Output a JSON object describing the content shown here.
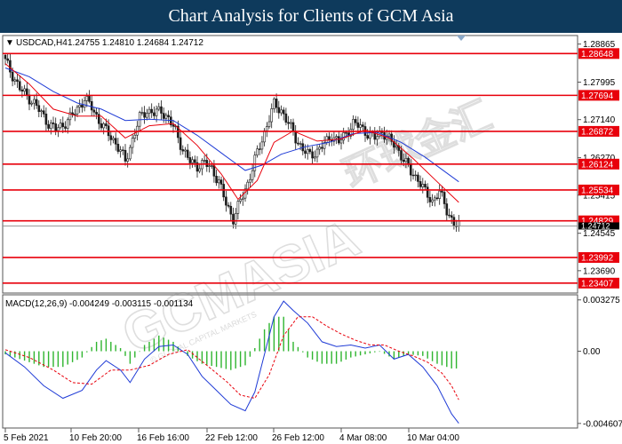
{
  "header": {
    "title": "Chart Analysis for Clients of GCM Asia"
  },
  "watermark": {
    "text": "GCMASIA",
    "subtext": "© GLOBAL CAPITAL MARKETS",
    "cjk": "环球金汇"
  },
  "colors": {
    "banner": "#0e3a5c",
    "candle": "#1c1c1c",
    "level_line": "#e8000b",
    "ma_fast": "#e8000b",
    "ma_slow": "#1f3bd6",
    "macd_hist": "#2fb52f",
    "macd_line": "#1f3bd6",
    "signal_line": "#e8000b",
    "current_price": "#8c8c8c"
  },
  "chart_data": [
    {
      "type": "candlestick",
      "title": "USDCAD,H4",
      "symbol": "USDCAD",
      "timeframe": "H4",
      "ohlc_label": "1.24755 1.24810 1.24684 1.24712",
      "ylim": [
        1.2318,
        1.2906
      ],
      "y_ticks": [
        "1.28865",
        "1.27995",
        "1.27140",
        "1.26270",
        "1.25415",
        "1.24545",
        "1.23690"
      ],
      "x_ticks": [
        "5 Feb 2021",
        "10 Feb 20:00",
        "16 Feb 16:00",
        "22 Feb 12:00",
        "26 Feb 12:00",
        "4 Mar 08:00",
        "10 Mar 04:00"
      ],
      "levels": [
        {
          "value": 1.28648,
          "label": "1.28648"
        },
        {
          "value": 1.27694,
          "label": "1.27694"
        },
        {
          "value": 1.26872,
          "label": "1.26872"
        },
        {
          "value": 1.26124,
          "label": "1.26124"
        },
        {
          "value": 1.25534,
          "label": "1.25534"
        },
        {
          "value": 1.24829,
          "label": "1.24829"
        },
        {
          "value": 1.23992,
          "label": "1.23992"
        },
        {
          "value": 1.23407,
          "label": "1.23407"
        }
      ],
      "current_price": {
        "value": 1.24712,
        "label": "1.24712"
      },
      "close_path": [
        [
          0,
          1.2848
        ],
        [
          3,
          1.2815
        ],
        [
          6,
          1.2785
        ],
        [
          9,
          1.2768
        ],
        [
          12,
          1.2752
        ],
        [
          15,
          1.2728
        ],
        [
          18,
          1.2705
        ],
        [
          21,
          1.2692
        ],
        [
          24,
          1.2702
        ],
        [
          27,
          1.2718
        ],
        [
          30,
          1.2738
        ],
        [
          33,
          1.2762
        ],
        [
          36,
          1.2742
        ],
        [
          39,
          1.2712
        ],
        [
          42,
          1.2688
        ],
        [
          45,
          1.2668
        ],
        [
          48,
          1.2642
        ],
        [
          50,
          1.2618
        ],
        [
          53,
          1.2668
        ],
        [
          56,
          1.2718
        ],
        [
          59,
          1.2735
        ],
        [
          62,
          1.2728
        ],
        [
          65,
          1.2735
        ],
        [
          68,
          1.2715
        ],
        [
          71,
          1.2688
        ],
        [
          74,
          1.2645
        ],
        [
          77,
          1.2618
        ],
        [
          80,
          1.2608
        ],
        [
          83,
          1.2615
        ],
        [
          86,
          1.2602
        ],
        [
          89,
          1.2572
        ],
        [
          92,
          1.2522
        ],
        [
          95,
          1.2488
        ],
        [
          98,
          1.2528
        ],
        [
          101,
          1.2568
        ],
        [
          104,
          1.2622
        ],
        [
          107,
          1.2668
        ],
        [
          110,
          1.2718
        ],
        [
          112,
          1.2748
        ],
        [
          115,
          1.2735
        ],
        [
          118,
          1.2705
        ],
        [
          121,
          1.2672
        ],
        [
          124,
          1.2645
        ],
        [
          127,
          1.2632
        ],
        [
          130,
          1.2642
        ],
        [
          133,
          1.2658
        ],
        [
          136,
          1.2678
        ],
        [
          139,
          1.2662
        ],
        [
          142,
          1.2682
        ],
        [
          145,
          1.2705
        ],
        [
          148,
          1.2698
        ],
        [
          151,
          1.2682
        ],
        [
          154,
          1.2672
        ],
        [
          157,
          1.2688
        ],
        [
          160,
          1.2668
        ],
        [
          163,
          1.2652
        ],
        [
          166,
          1.2622
        ],
        [
          169,
          1.2595
        ],
        [
          172,
          1.2578
        ],
        [
          175,
          1.2548
        ],
        [
          178,
          1.2528
        ],
        [
          181,
          1.2548
        ],
        [
          184,
          1.2508
        ],
        [
          187,
          1.2475
        ],
        [
          189,
          1.2471
        ]
      ],
      "ma_fast": [
        [
          0,
          1.2842
        ],
        [
          10,
          1.2795
        ],
        [
          20,
          1.2738
        ],
        [
          30,
          1.2722
        ],
        [
          40,
          1.2722
        ],
        [
          50,
          1.2672
        ],
        [
          60,
          1.27
        ],
        [
          70,
          1.2705
        ],
        [
          80,
          1.2655
        ],
        [
          90,
          1.259
        ],
        [
          97,
          1.2532
        ],
        [
          105,
          1.2575
        ],
        [
          112,
          1.2662
        ],
        [
          120,
          1.2688
        ],
        [
          130,
          1.2665
        ],
        [
          140,
          1.267
        ],
        [
          150,
          1.269
        ],
        [
          160,
          1.2672
        ],
        [
          170,
          1.2625
        ],
        [
          180,
          1.2572
        ],
        [
          189,
          1.2525
        ]
      ],
      "ma_slow": [
        [
          0,
          1.2832
        ],
        [
          10,
          1.2812
        ],
        [
          20,
          1.2778
        ],
        [
          30,
          1.2752
        ],
        [
          40,
          1.2738
        ],
        [
          50,
          1.2712
        ],
        [
          60,
          1.2715
        ],
        [
          70,
          1.2712
        ],
        [
          80,
          1.2678
        ],
        [
          90,
          1.2638
        ],
        [
          100,
          1.2598
        ],
        [
          107,
          1.261
        ],
        [
          115,
          1.2635
        ],
        [
          125,
          1.2652
        ],
        [
          135,
          1.2662
        ],
        [
          145,
          1.2682
        ],
        [
          155,
          1.2685
        ],
        [
          165,
          1.2662
        ],
        [
          175,
          1.2628
        ],
        [
          185,
          1.2588
        ],
        [
          189,
          1.2572
        ]
      ]
    },
    {
      "type": "macd",
      "title": "MACD(12,26,9)",
      "values_label": "-0.004249 -0.003115 -0.001134",
      "ylim": [
        -0.0049,
        0.0036
      ],
      "y_ticks": [
        "0.003275",
        "0.00",
        "-0.004607"
      ],
      "macd": [
        [
          0,
          -0.0001
        ],
        [
          8,
          -0.001
        ],
        [
          16,
          -0.0022
        ],
        [
          24,
          -0.003
        ],
        [
          32,
          -0.0025
        ],
        [
          38,
          -0.0012
        ],
        [
          42,
          -0.0006
        ],
        [
          48,
          -0.0012
        ],
        [
          52,
          -0.002
        ],
        [
          58,
          -0.0005
        ],
        [
          64,
          0.0003
        ],
        [
          70,
          0.0004
        ],
        [
          76,
          -0.0002
        ],
        [
          82,
          -0.0016
        ],
        [
          88,
          -0.0025
        ],
        [
          94,
          -0.0034
        ],
        [
          100,
          -0.0038
        ],
        [
          104,
          -0.0026
        ],
        [
          108,
          -0.0002
        ],
        [
          112,
          0.0022
        ],
        [
          116,
          0.0032
        ],
        [
          120,
          0.0026
        ],
        [
          126,
          0.0018
        ],
        [
          132,
          0.0006
        ],
        [
          138,
          0.0003
        ],
        [
          144,
          0.0004
        ],
        [
          150,
          0.0002
        ],
        [
          156,
          0.0004
        ],
        [
          162,
          -0.0005
        ],
        [
          168,
          -0.0002
        ],
        [
          174,
          -0.001
        ],
        [
          180,
          -0.0022
        ],
        [
          186,
          -0.004
        ],
        [
          189,
          -0.0046
        ]
      ],
      "signal": [
        [
          0,
          0.0001
        ],
        [
          10,
          -0.0004
        ],
        [
          20,
          -0.0012
        ],
        [
          28,
          -0.002
        ],
        [
          36,
          -0.0021
        ],
        [
          44,
          -0.0012
        ],
        [
          52,
          -0.0012
        ],
        [
          60,
          -0.0009
        ],
        [
          68,
          -0.0002
        ],
        [
          76,
          0.0001
        ],
        [
          84,
          -0.0009
        ],
        [
          92,
          -0.0019
        ],
        [
          98,
          -0.0028
        ],
        [
          104,
          -0.003
        ],
        [
          110,
          -0.0015
        ],
        [
          116,
          0.001
        ],
        [
          122,
          0.0022
        ],
        [
          128,
          0.0022
        ],
        [
          134,
          0.0016
        ],
        [
          140,
          0.0011
        ],
        [
          146,
          0.0007
        ],
        [
          152,
          0.0004
        ],
        [
          158,
          0.0004
        ],
        [
          164,
          0.0
        ],
        [
          170,
          -0.0003
        ],
        [
          176,
          -0.0007
        ],
        [
          182,
          -0.0014
        ],
        [
          186,
          -0.0022
        ],
        [
          189,
          -0.0031
        ]
      ],
      "histogram": [
        [
          0,
          -0.0002
        ],
        [
          8,
          -0.0006
        ],
        [
          16,
          -0.001
        ],
        [
          24,
          -0.001
        ],
        [
          32,
          -0.0004
        ],
        [
          38,
          0.0006
        ],
        [
          42,
          0.0008
        ],
        [
          48,
          0.0002
        ],
        [
          52,
          -0.0008
        ],
        [
          58,
          0.0004
        ],
        [
          64,
          0.001
        ],
        [
          70,
          0.0006
        ],
        [
          76,
          -0.0003
        ],
        [
          82,
          -0.0008
        ],
        [
          88,
          -0.001
        ],
        [
          94,
          -0.0012
        ],
        [
          100,
          -0.0009
        ],
        [
          104,
          0.0002
        ],
        [
          108,
          0.0014
        ],
        [
          112,
          0.0022
        ],
        [
          116,
          0.0022
        ],
        [
          120,
          0.0006
        ],
        [
          126,
          -0.0004
        ],
        [
          132,
          -0.0008
        ],
        [
          138,
          -0.0008
        ],
        [
          144,
          -0.0004
        ],
        [
          150,
          -0.0002
        ],
        [
          156,
          0.0
        ],
        [
          162,
          -0.0005
        ],
        [
          168,
          -0.0002
        ],
        [
          174,
          -0.0003
        ],
        [
          180,
          -0.0008
        ],
        [
          186,
          -0.0011
        ],
        [
          189,
          -0.0011
        ]
      ]
    }
  ]
}
